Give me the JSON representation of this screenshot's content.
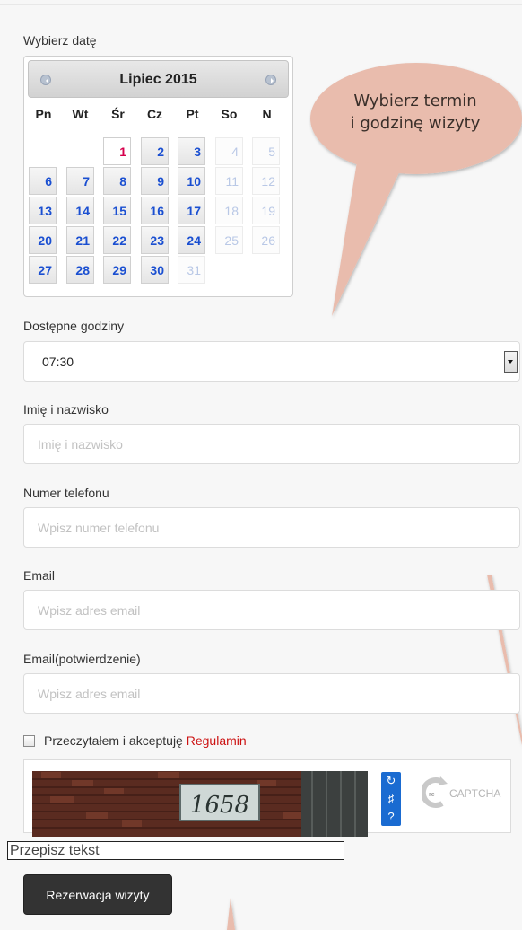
{
  "calendar_section": {
    "label": "Wybierz datę"
  },
  "calendar": {
    "title": "Lipiec 2015",
    "weekdays": [
      "Pn",
      "Wt",
      "Śr",
      "Cz",
      "Pt",
      "So",
      "N"
    ],
    "weeks": [
      [
        null,
        null,
        {
          "d": "1",
          "s": "today"
        },
        {
          "d": "2",
          "s": "available"
        },
        {
          "d": "3",
          "s": "available"
        },
        {
          "d": "4",
          "s": "disabled"
        },
        {
          "d": "5",
          "s": "disabled"
        }
      ],
      [
        {
          "d": "6",
          "s": "available"
        },
        {
          "d": "7",
          "s": "available"
        },
        {
          "d": "8",
          "s": "available"
        },
        {
          "d": "9",
          "s": "available"
        },
        {
          "d": "10",
          "s": "available"
        },
        {
          "d": "11",
          "s": "disabled"
        },
        {
          "d": "12",
          "s": "disabled"
        }
      ],
      [
        {
          "d": "13",
          "s": "available"
        },
        {
          "d": "14",
          "s": "available"
        },
        {
          "d": "15",
          "s": "available"
        },
        {
          "d": "16",
          "s": "available"
        },
        {
          "d": "17",
          "s": "available"
        },
        {
          "d": "18",
          "s": "disabled"
        },
        {
          "d": "19",
          "s": "disabled"
        }
      ],
      [
        {
          "d": "20",
          "s": "available"
        },
        {
          "d": "21",
          "s": "available"
        },
        {
          "d": "22",
          "s": "available"
        },
        {
          "d": "23",
          "s": "available"
        },
        {
          "d": "24",
          "s": "available"
        },
        {
          "d": "25",
          "s": "disabled"
        },
        {
          "d": "26",
          "s": "disabled"
        }
      ],
      [
        {
          "d": "27",
          "s": "available"
        },
        {
          "d": "28",
          "s": "available"
        },
        {
          "d": "29",
          "s": "available"
        },
        {
          "d": "30",
          "s": "available"
        },
        {
          "d": "31",
          "s": "disabled"
        },
        null,
        null
      ]
    ]
  },
  "annotation": {
    "line1": "Wybierz termin",
    "line2": "i godzinę wizyty"
  },
  "hours": {
    "label": "Dostępne godziny",
    "selected": "07:30"
  },
  "name": {
    "label": "Imię i nazwisko",
    "placeholder": "Imię i nazwisko"
  },
  "phone": {
    "label": "Numer telefonu",
    "placeholder": "Wpisz numer telefonu"
  },
  "email": {
    "label": "Email",
    "placeholder": "Wpisz adres email"
  },
  "email_confirm": {
    "label": "Email(potwierdzenie)",
    "placeholder": "Wpisz adres email"
  },
  "terms": {
    "text": "Przeczytałem i akceptuję ",
    "link": "Regulamin"
  },
  "captcha": {
    "image_text": "1658",
    "input_placeholder": "Przepisz tekst",
    "logo": "CAPTCHA",
    "logo_prefix": "re"
  },
  "submit": {
    "label": "Rezerwacja wizyty"
  },
  "colors": {
    "bubble": "#e9bcad",
    "link": "#cc1111",
    "day": "#1a4fd1",
    "today": "#d6004c"
  }
}
